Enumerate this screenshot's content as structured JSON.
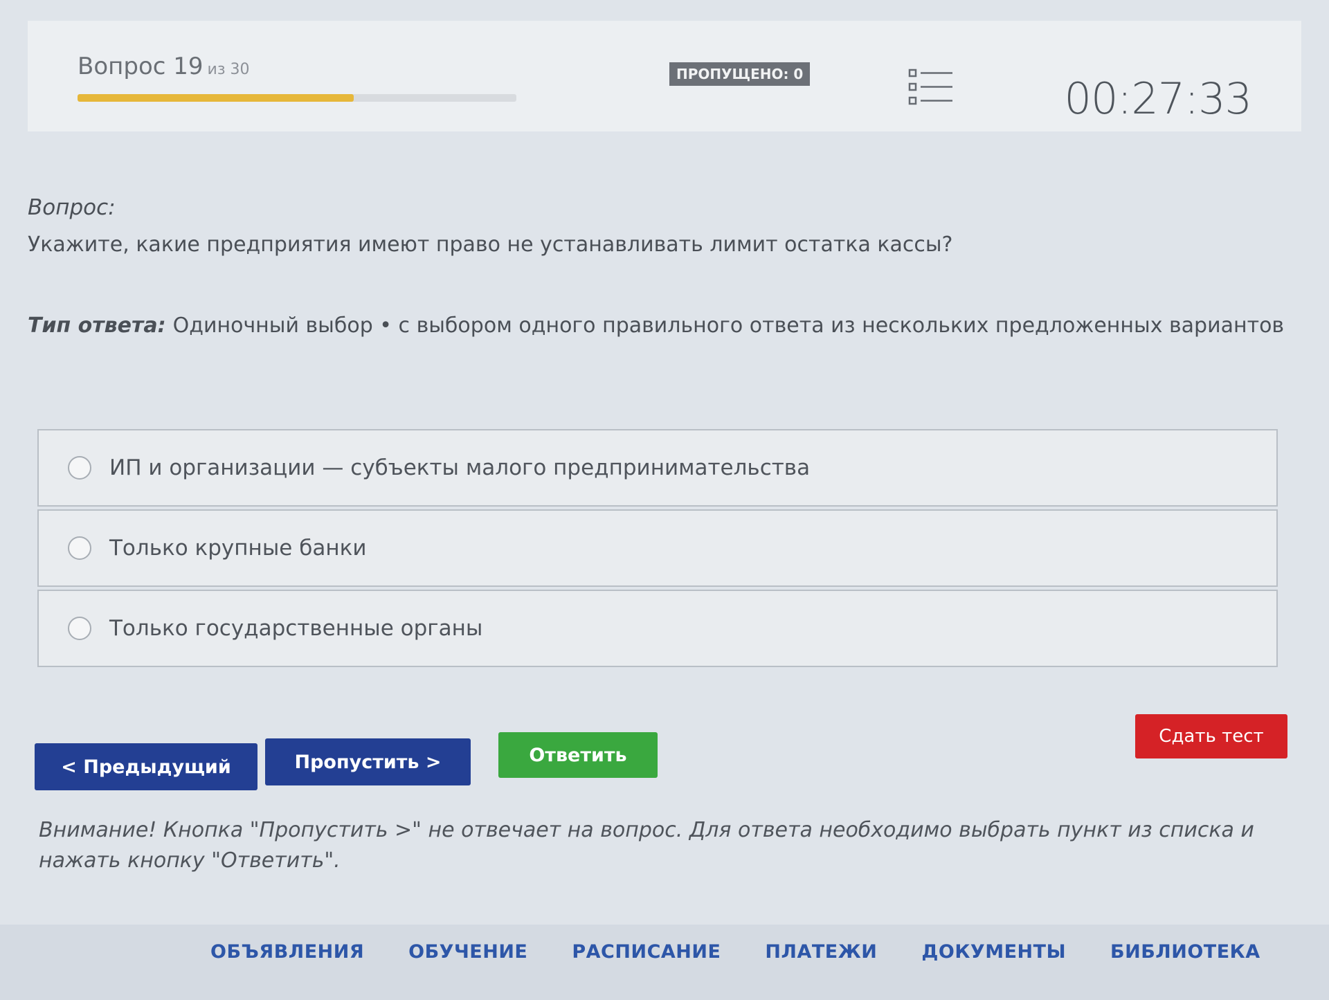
{
  "header": {
    "question_label": "Вопрос 19",
    "question_of": "из 30",
    "progress": 0.63,
    "skipped_badge": "ПРОПУЩЕНО: 0",
    "timer": "00:27:33"
  },
  "question": {
    "label": "Вопрос:",
    "text": "Укажите, какие предприятия имеют право не устанавливать лимит остатка кассы?",
    "answer_type_label": "Тип ответа:",
    "answer_type_text": "Одиночный выбор • с выбором одного правильного ответа из нескольких предложенных вариантов"
  },
  "options": [
    "ИП и организации — субъекты малого предпринимательства",
    "Только крупные банки",
    "Только государственные органы"
  ],
  "buttons": {
    "prev": "< Предыдущий",
    "skip": "Пропустить >",
    "answer": "Ответить",
    "submit": "Сдать тест"
  },
  "notice": "Внимание! Кнопка \"Пропустить >\" не отвечает на вопрос. Для ответа необходимо выбрать пункт из списка и нажать кнопку \"Ответить\".",
  "footer_nav": [
    "ОБЪЯВЛЕНИЯ",
    "ОБУЧЕНИЕ",
    "РАСПИСАНИЕ",
    "ПЛАТЕЖИ",
    "ДОКУМЕНТЫ",
    "БИБЛИОТЕКА"
  ],
  "colors": {
    "progress": "#e6b73a",
    "primary_button": "#233f93",
    "answer_button": "#3aa83f",
    "submit_button": "#d52226",
    "nav_link": "#2d56a8"
  }
}
